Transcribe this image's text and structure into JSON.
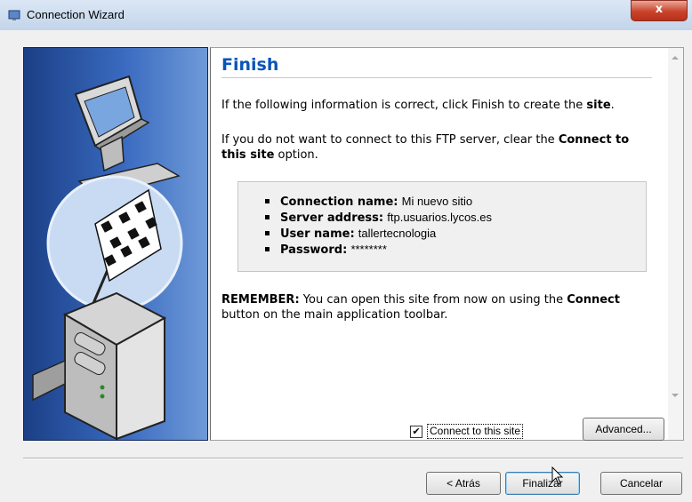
{
  "window": {
    "title": "Connection Wizard",
    "close_label": "x"
  },
  "page": {
    "heading": "Finish",
    "para1": {
      "before": "If the following information is correct, click Finish to create the ",
      "bold": "site",
      "after": "."
    },
    "para2": {
      "before": "If you do not want to connect to this FTP server, clear the ",
      "bold": "Connect to this site",
      "after": " option."
    },
    "info": [
      {
        "label": "Connection name:",
        "value": "Mi nuevo sitio"
      },
      {
        "label": "Server address:",
        "value": "ftp.usuarios.lycos.es"
      },
      {
        "label": "User name:",
        "value": "tallertecnologia"
      },
      {
        "label": "Password:",
        "value": "********"
      }
    ],
    "remember": {
      "bold1": "REMEMBER:",
      "text1": " You can open this site from now on using the ",
      "bold2": "Connect",
      "text2": " button on the main application toolbar."
    }
  },
  "options": {
    "connect_checkbox_label": "Connect to this site",
    "connect_checked": true,
    "advanced_label": "Advanced..."
  },
  "buttons": {
    "back": "< Atrás",
    "finish": "Finalizar",
    "cancel": "Cancelar"
  },
  "icons": {
    "side_illustration": "computers-checkered-flag-icon"
  }
}
